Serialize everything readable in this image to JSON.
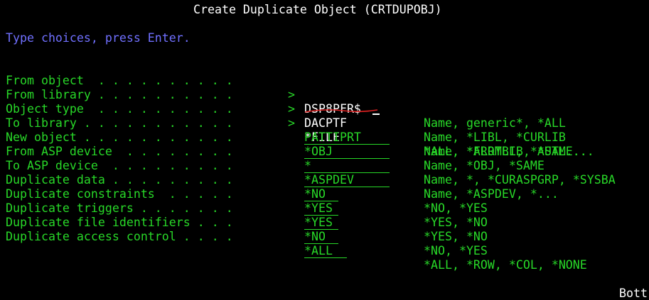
{
  "screen": {
    "title": "Create Duplicate Object (CRTDUPOBJ)",
    "instruction": "Type choices, press Enter."
  },
  "fields": [
    {
      "label": "From object  . . . . . . . . . .",
      "value": "DSP8PFR$",
      "hint": "Name, generic*, *ALL"
    },
    {
      "label": "From library . . . . . . . . . .",
      "value": "DACPTF",
      "hint": "Name, *LIBL, *CURLIB"
    },
    {
      "label": "Object type  . . . . . . . . . .",
      "value": "*FILE",
      "hint": "*ALL, *ALRTBL, *AUTL..."
    },
    {
      "label": "To library . . . . . . . . . . .",
      "value": "PATTIPRT",
      "hint": "Name, *FROMLIB, *SAME..."
    },
    {
      "label": "New object . . . . . . . . . . .",
      "value": "*OBJ",
      "hint": "Name, *OBJ, *SAME"
    },
    {
      "label": "From ASP device  . . . . . . . .",
      "value": "*",
      "hint": "Name, *, *CURASPGRP, *SYSBA"
    },
    {
      "label": "To ASP device  . . . . . . . . .",
      "value": "*ASPDEV",
      "hint": "Name, *ASPDEV, *..."
    },
    {
      "label": "Duplicate data . . . . . . . . .",
      "value": "*NO",
      "hint": "*NO, *YES"
    },
    {
      "label": "Duplicate constraints  . . . . .",
      "value": "*YES",
      "hint": "*YES, *NO"
    },
    {
      "label": "Duplicate triggers . . . . . . .",
      "value": "*YES",
      "hint": "*YES, *NO"
    },
    {
      "label": "Duplicate file identifiers . . .",
      "value": "*NO",
      "hint": "*NO, *YES"
    },
    {
      "label": "Duplicate access control . . . .",
      "value": "*ALL",
      "hint": "*ALL, *ROW, *COL, *NONE"
    }
  ],
  "arrow": ">",
  "footer": {
    "more": "Bott"
  },
  "colors": {
    "background": "#000000",
    "field_text": "#28d828",
    "title_text": "#ffffff",
    "instruction_text": "#7070ff",
    "annotation": "#e02020"
  }
}
